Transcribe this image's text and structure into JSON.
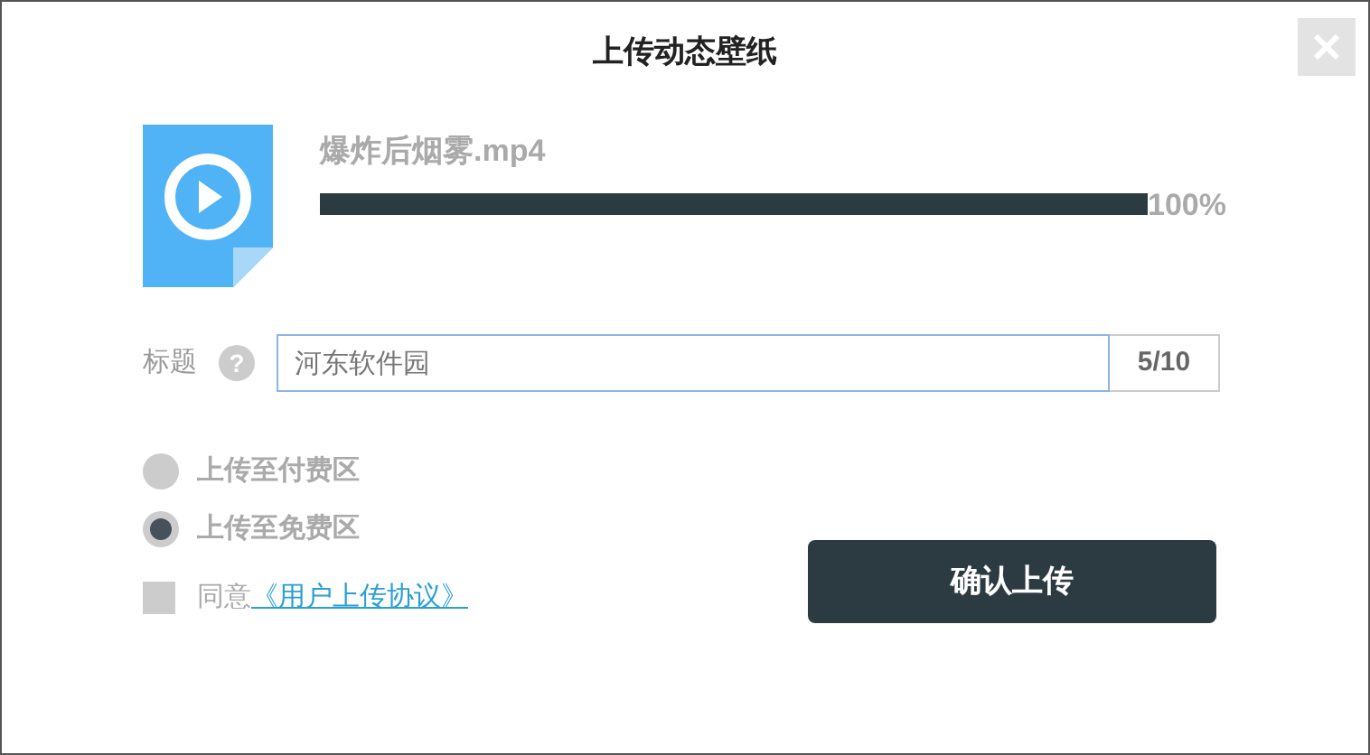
{
  "window": {
    "title": "上传动态壁纸"
  },
  "file": {
    "name": "爆炸后烟雾.mp4",
    "level": 1,
    "percent": "100%"
  },
  "title_field": {
    "label": "标题",
    "help": "?",
    "value": "河东软件园",
    "counter": "5/10"
  },
  "zones": [
    {
      "label": "上传至付费区",
      "selected": false
    },
    {
      "label": "上传至免费区",
      "selected": true
    }
  ],
  "agreement": {
    "checked": false,
    "text": "同意",
    "link": "《用户上传协议》"
  },
  "submit": "确认上传"
}
